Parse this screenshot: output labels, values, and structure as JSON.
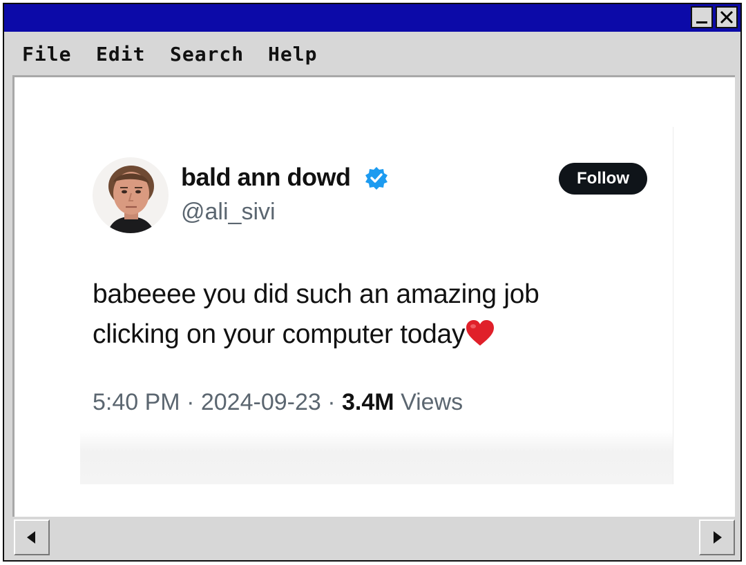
{
  "menu": {
    "items": [
      {
        "label": "File"
      },
      {
        "label": "Edit"
      },
      {
        "label": "Search"
      },
      {
        "label": "Help"
      }
    ]
  },
  "title_buttons": {
    "minimize_icon": "minimize-icon",
    "close_icon": "close-icon"
  },
  "tweet": {
    "display_name": "bald ann dowd",
    "handle": "@ali_sivi",
    "follow_label": "Follow",
    "text_line1": "babeeee you did such an amazing job",
    "text_line2": "clicking on your computer today",
    "time": "5:40 PM",
    "date": "2024-09-23",
    "separator": "·",
    "view_count": "3.4M",
    "views_label": "Views",
    "verified_icon": "verified-badge-icon",
    "heart_icon": "heart-emoji-icon"
  },
  "colors": {
    "titlebar": "#0c0aa8",
    "window_bg": "#d7d7d7",
    "verified_blue": "#1d9bf0",
    "follow_bg": "#0f1419",
    "heart_red": "#e0202a"
  }
}
